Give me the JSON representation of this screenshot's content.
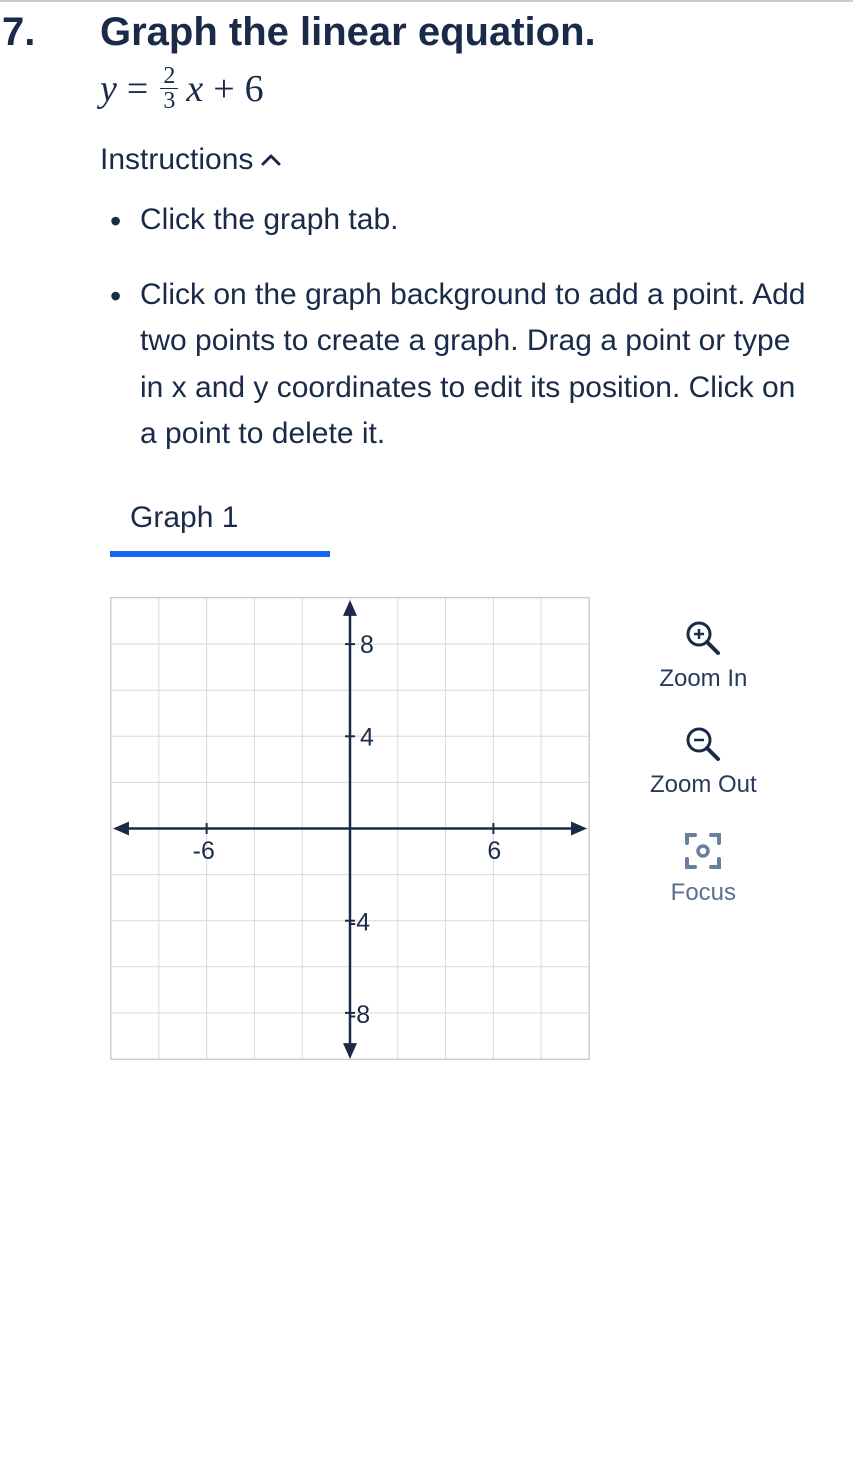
{
  "question": {
    "number": "7.",
    "title": "Graph the linear equation.",
    "equation": {
      "lhs": "y",
      "equals": "=",
      "frac_num": "2",
      "frac_den": "3",
      "var": "x",
      "plus": "+",
      "constant": "6"
    }
  },
  "instructions": {
    "header": "Instructions",
    "items": [
      "Click the graph tab.",
      "Click on the graph background to add a point. Add two points to create a graph. Drag a point or type in x and y coordinates to edit its position. Click on a point to delete it."
    ]
  },
  "tab": {
    "label": "Graph 1"
  },
  "graph": {
    "x_range": [
      -10,
      10
    ],
    "y_range": [
      -10,
      10
    ],
    "x_ticks": [
      -6,
      6
    ],
    "y_ticks": [
      8,
      4,
      -4,
      -8
    ]
  },
  "controls": {
    "zoom_in": "Zoom In",
    "zoom_out": "Zoom Out",
    "focus": "Focus"
  }
}
